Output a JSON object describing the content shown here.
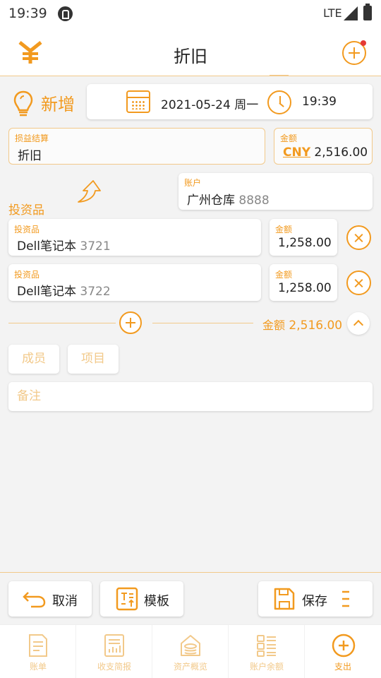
{
  "status_bar": {
    "time": "19:39",
    "network": "LTE"
  },
  "app_bar": {
    "title": "折旧"
  },
  "entry": {
    "mode_label": "新增",
    "date": "2021-05-24 周一",
    "time": "19:39"
  },
  "category": {
    "label": "损益结算",
    "value": "折旧"
  },
  "amount": {
    "label": "金额",
    "currency": "CNY",
    "value": "2,516.00"
  },
  "account": {
    "label": "账户",
    "name": "广州仓库",
    "code": "8888"
  },
  "investments": {
    "title": "投资品",
    "items": [
      {
        "label": "投资品",
        "name": "Dell笔记本",
        "code": "3721",
        "amount_label": "金额",
        "amount": "1,258.00"
      },
      {
        "label": "投资品",
        "name": "Dell笔记本",
        "code": "3722",
        "amount_label": "金额",
        "amount": "1,258.00"
      }
    ],
    "total_label": "金额",
    "total": "2,516.00"
  },
  "chips": {
    "member": "成员",
    "project": "项目"
  },
  "notes": {
    "placeholder": "备注"
  },
  "actions": {
    "cancel": "取消",
    "template": "模板",
    "save": "保存"
  },
  "tabs": [
    {
      "label": "账单"
    },
    {
      "label": "收支简报"
    },
    {
      "label": "资产概览"
    },
    {
      "label": "账户余额"
    },
    {
      "label": "支出"
    }
  ],
  "colors": {
    "accent": "#f29a1f",
    "accent_light": "#f2c98a",
    "alert_dot": "#e53935"
  }
}
